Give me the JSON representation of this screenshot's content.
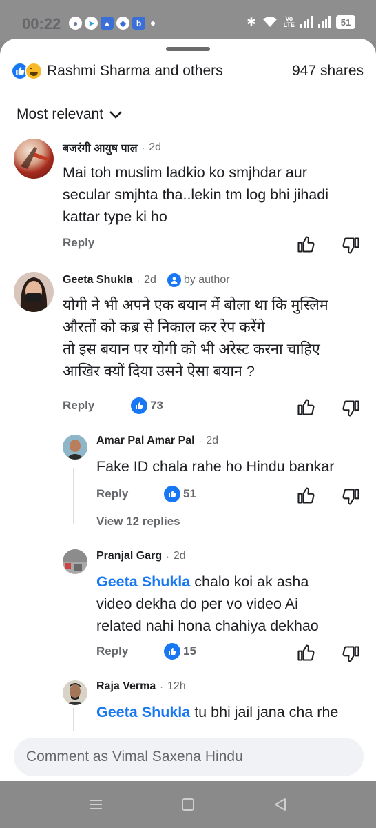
{
  "status_bar": {
    "time": "00:22",
    "app_icons": [
      "chat-bubble",
      "telegram",
      "arc",
      "location",
      "b"
    ],
    "volte_label": "Vo\nLTE",
    "battery": "51"
  },
  "header": {
    "reaction_names": "Rashmi Sharma and others",
    "shares": "947 shares"
  },
  "sort": {
    "label": "Most relevant"
  },
  "comments": [
    {
      "name": "बजरंगी आयुष पाल",
      "time": "2d",
      "text_lines": [
        "Mai toh muslim ladkio ko smjhdar aur",
        "secular smjhta tha..lekin tm log bhi jihadi",
        "kattar type ki ho"
      ],
      "reply": "Reply"
    },
    {
      "name": "Geeta Shukla",
      "time": "2d",
      "badge": "by author",
      "text_lines": [
        "योगी ने भी अपने एक बयान में बोला था कि मुस्लिम",
        "औरतों को कब्र से निकाल कर रेप करेंगे",
        "तो इस बयान पर योगी को भी अरेस्ट करना चाहिए",
        "आखिर क्यों दिया उसने ऐसा बयान ?"
      ],
      "reply": "Reply",
      "likes": "73"
    }
  ],
  "replies": [
    {
      "name": "Amar Pal Amar Pal",
      "time": "2d",
      "text_lines": [
        "Fake ID chala rahe ho Hindu bankar"
      ],
      "reply": "Reply",
      "likes": "51",
      "view_replies": "View 12 replies"
    },
    {
      "name": "Pranjal Garg",
      "time": "2d",
      "mention": "Geeta Shukla",
      "text_lines": [
        " chalo koi ak asha",
        "video dekha do per vo video Ai",
        "related nahi hona chahiya dekhao"
      ],
      "reply": "Reply",
      "likes": "15"
    },
    {
      "name": "Raja Verma",
      "time": "12h",
      "mention": "Geeta Shukla",
      "text_lines": [
        " tu bhi jail jana cha rhe"
      ]
    }
  ],
  "composer": {
    "placeholder": "Comment as Vimal Saxena Hindu"
  },
  "colors": {
    "accent": "#1877f2",
    "secondary_text": "#65676b",
    "statusbar_bg": "#8e8e8e"
  }
}
